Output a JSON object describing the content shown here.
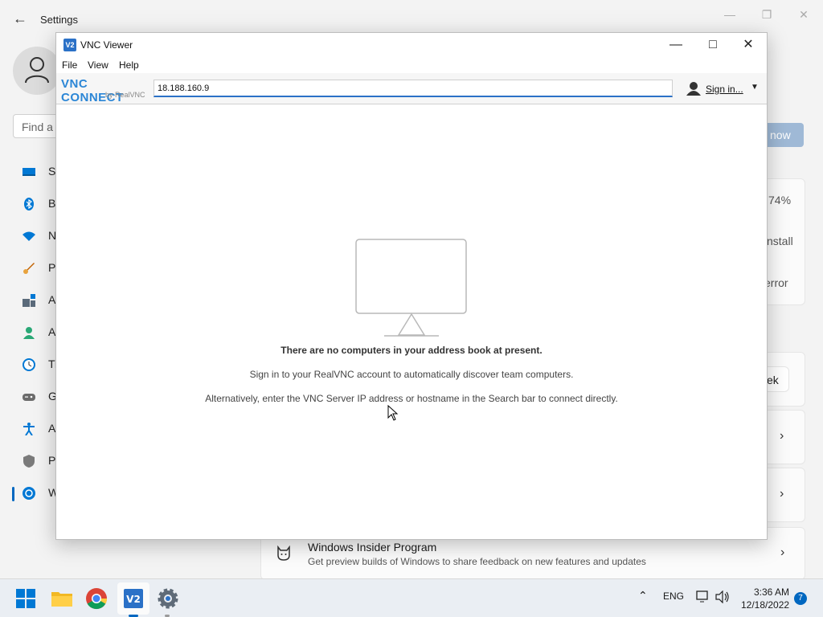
{
  "settings": {
    "title": "Settings",
    "search_placeholder": "Find a s",
    "nav_items": [
      "Sy",
      "Bl",
      "N",
      "Pe",
      "A",
      "A",
      "Ti",
      "G",
      "A",
      "Pr",
      "W"
    ],
    "right_button": "now",
    "card_texts": [
      "74%",
      "nstall",
      "error",
      "ek"
    ],
    "insider_title": "Windows Insider Program",
    "insider_subtitle": "Get preview builds of Windows to share feedback on new features and updates"
  },
  "vnc": {
    "title": "VNC Viewer",
    "menu": [
      "File",
      "View",
      "Help"
    ],
    "logo_main": "VNC CONNECT",
    "logo_sub": "by RealVNC",
    "address_value": "18.188.160.9",
    "signin_label": "Sign in...",
    "empty_title": "There are no computers in your address book at present.",
    "empty_line1": "Sign in to your RealVNC account to automatically discover team computers.",
    "empty_line2": "Alternatively, enter the VNC Server IP address or hostname in the Search bar to connect directly."
  },
  "taskbar": {
    "lang": "ENG",
    "time": "3:36 AM",
    "date": "12/18/2022",
    "notifications": "7"
  }
}
